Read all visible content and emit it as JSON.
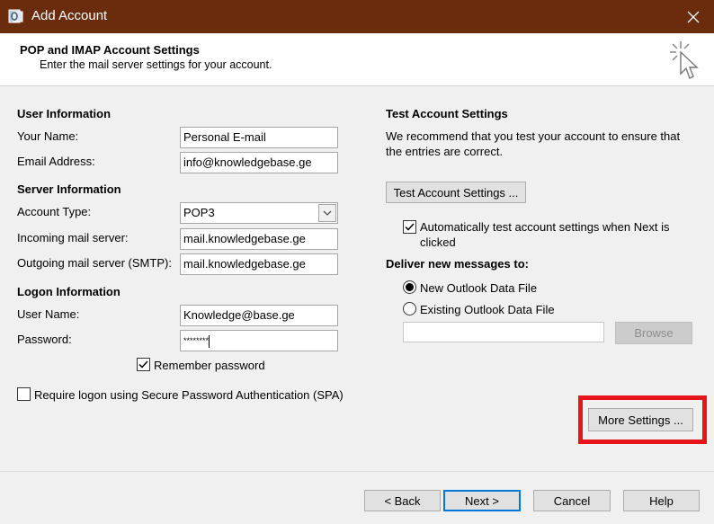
{
  "window": {
    "title": "Add Account",
    "close_icon": "close-icon",
    "app_icon": "outlook-icon"
  },
  "header": {
    "title": "POP and IMAP Account Settings",
    "subtitle": "Enter the mail server settings for your account.",
    "icon": "pointer-cursor-icon"
  },
  "user_info": {
    "heading": "User Information",
    "name_label": "Your Name:",
    "name_value": "Personal E-mail",
    "email_label": "Email Address:",
    "email_value": "info@knowledgebase.ge"
  },
  "server_info": {
    "heading": "Server Information",
    "account_type_label": "Account Type:",
    "account_type_value": "POP3",
    "incoming_label": "Incoming mail server:",
    "incoming_value": "mail.knowledgebase.ge",
    "outgoing_label": "Outgoing mail server (SMTP):",
    "outgoing_value": "mail.knowledgebase.ge"
  },
  "logon_info": {
    "heading": "Logon Information",
    "username_label": "User Name:",
    "username_value": "Knowledge@base.ge",
    "password_label": "Password:",
    "password_value": "********",
    "remember_label": "Remember password",
    "remember_checked": true,
    "spa_label": "Require logon using Secure Password Authentication (SPA)",
    "spa_checked": false
  },
  "test_settings": {
    "heading": "Test Account Settings",
    "description_line1": "We recommend that you test your account to ensure that",
    "description_line2": "the entries are correct.",
    "test_button": "Test Account Settings ...",
    "auto_test_line1": "Automatically test account settings when Next is",
    "auto_test_line2": "clicked",
    "auto_test_checked": true
  },
  "deliver": {
    "heading": "Deliver new messages to:",
    "new_file_label": "New Outlook Data File",
    "existing_file_label": "Existing Outlook Data File",
    "selected": "new",
    "existing_path_value": "",
    "browse_button": "Browse"
  },
  "more_settings_button": "More Settings ...",
  "footer": {
    "back_button": "< Back",
    "next_button": "Next >",
    "cancel_button": "Cancel",
    "help_button": "Help"
  },
  "colors": {
    "titlebar": "#6b2c0e",
    "highlight": "#e8141c",
    "primary_border": "#0078d7"
  }
}
